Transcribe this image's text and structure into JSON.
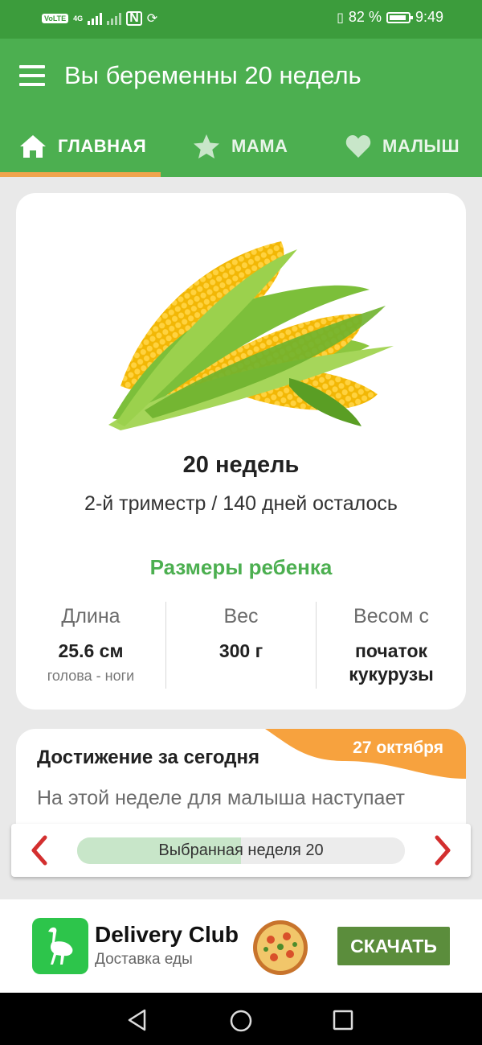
{
  "status_bar": {
    "volte": "VoLTE",
    "network": "4G",
    "battery_percent": "82 %",
    "time": "9:49"
  },
  "app_bar": {
    "title": "Вы беременны 20 недель"
  },
  "tabs": [
    {
      "label": "ГЛАВНАЯ",
      "icon": "home-icon",
      "active": true
    },
    {
      "label": "МАМА",
      "icon": "star-icon",
      "active": false
    },
    {
      "label": "МАЛЫШ",
      "icon": "heart-icon",
      "active": false
    }
  ],
  "week_card": {
    "title": "20 недель",
    "subtitle": "2-й триместр / 140 дней осталось",
    "sizes_title": "Размеры ребенка",
    "stats": [
      {
        "label": "Длина",
        "value": "25.6 см",
        "sub": "голова - ноги"
      },
      {
        "label": "Вес",
        "value": "300 г",
        "sub": ""
      },
      {
        "label": "Весом с",
        "value": "початок кукурузы",
        "sub": ""
      }
    ]
  },
  "achievement": {
    "title": "Достижение за сегодня",
    "date": "27 октября",
    "text": "На этой неделе для малыша наступает"
  },
  "week_nav": {
    "label": "Выбранная неделя 20",
    "progress": 0.5
  },
  "ad": {
    "name": "Delivery Club",
    "description": "Доставка еды",
    "button_label": "СКАЧАТЬ"
  },
  "colors": {
    "primary": "#4caf50",
    "status_bar": "#3c9c3c",
    "accent": "#f0a44d",
    "ad_button": "#5b8d3c",
    "arrow": "#d32f2f"
  }
}
